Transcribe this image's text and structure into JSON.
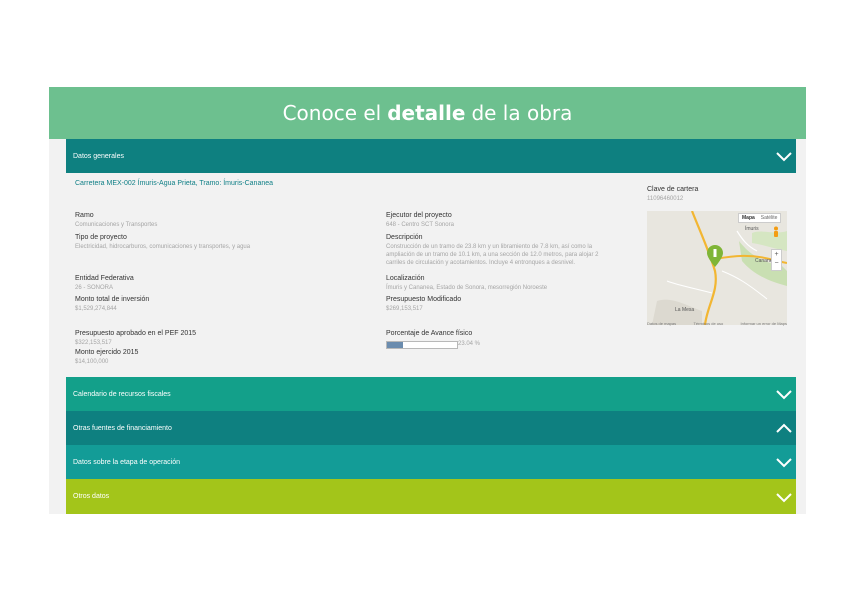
{
  "header": {
    "prefix": "Conoce el",
    "bold": "detalle",
    "suffix": "de la obra"
  },
  "colors": {
    "header": "#6dc08f",
    "teal_dark": "#0e8080",
    "teal": "#13a08a",
    "teal_mid": "#139c97",
    "lime": "#a3c51a"
  },
  "sections": [
    {
      "label": "Datos generales",
      "state": "expanded"
    },
    {
      "label": "Calendario de recursos fiscales",
      "state": "collapsed"
    },
    {
      "label": "Otras fuentes de financiamiento",
      "state": "expanded"
    },
    {
      "label": "Datos sobre la etapa de operación",
      "state": "collapsed"
    },
    {
      "label": "Otros datos",
      "state": "collapsed"
    }
  ],
  "project": {
    "name": "Carretera MEX-002 Ímuris-Agua Prieta, Tramo: Ímuris-Cananea",
    "clave_label": "Clave de cartera",
    "clave_value": "11096460012",
    "ramo_label": "Ramo",
    "ramo_value": "Comunicaciones y Transportes",
    "tipo_label": "Tipo de proyecto",
    "tipo_value": "Electricidad, hidrocarburos, comunicaciones y transportes, y agua",
    "entidad_label": "Entidad Federativa",
    "entidad_value": "26 - SONORA",
    "monto_total_label": "Monto total de inversión",
    "monto_total_value": "$1,529,274,844",
    "presupuesto_pef_label": "Presupuesto aprobado en el PEF 2015",
    "presupuesto_pef_value": "$322,153,517",
    "monto_ejercido_label": "Monto ejercido 2015",
    "monto_ejercido_value": "$14,100,000",
    "ejecutor_label": "Ejecutor del proyecto",
    "ejecutor_value": "648 - Centro SCT Sonora",
    "descripcion_label": "Descripción",
    "descripcion_lines": [
      "Construcción de un tramo de 23.8 km y un libramiento de 7.8 km, así como la",
      "ampliación de un tramo de 10.1 km, a una sección de 12.0 metros, para alojar 2",
      "carriles de circulación y acotamientos. Incluye 4 entronques a desnivel."
    ],
    "localizacion_label": "Localización",
    "localizacion_value": "Ímuris y Cananea, Estado de Sonora, mesorregión Noroeste",
    "presupuesto_mod_label": "Presupuesto Modificado",
    "presupuesto_mod_value": "$269,153,517",
    "avance_label": "Porcentaje de Avance físico",
    "avance_value": "23.04 %",
    "avance_fraction": 0.2304
  },
  "map": {
    "btn_mapa": "Mapa",
    "btn_satelite": "Satélite",
    "places": [
      "Ímuris",
      "Cananea",
      "La Mesa"
    ],
    "zoom_in": "+",
    "zoom_out": "−",
    "footer_left": "Datos de mapas",
    "footer_mid": "Términos de uso",
    "footer_right": "Informar un error de Maps"
  }
}
